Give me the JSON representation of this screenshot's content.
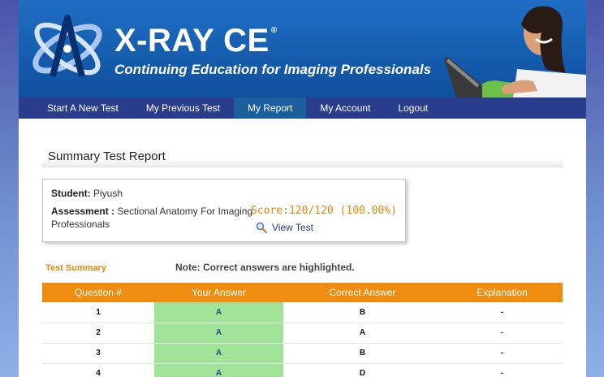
{
  "header": {
    "brand": "X-RAY CE",
    "brand_mark": "®",
    "tagline": "Continuing Education for Imaging Professionals"
  },
  "nav": {
    "items": [
      {
        "label": "Start A New Test",
        "active": false
      },
      {
        "label": "My Previous Test",
        "active": false
      },
      {
        "label": "My Report",
        "active": true
      },
      {
        "label": "My Account",
        "active": false
      },
      {
        "label": "Logout",
        "active": false
      }
    ]
  },
  "report": {
    "title": "Summary Test Report",
    "student_label": "Student:",
    "student_name": "Piyush",
    "assessment_label": "Assessment :",
    "assessment_name": "Sectional Anatomy For Imaging Professionals",
    "score": "Score:120/120 (100.00%)",
    "view_test": "View Test",
    "summary_label": "Test Summary",
    "note": "Note: Correct answers are highlighted."
  },
  "table": {
    "headers": [
      "Question #",
      "Your Answer",
      "Correct Answer",
      "Explanation"
    ],
    "rows": [
      [
        "1",
        "A",
        "B",
        "-"
      ],
      [
        "2",
        "A",
        "A",
        "-"
      ],
      [
        "3",
        "A",
        "B",
        "-"
      ],
      [
        "4",
        "A",
        "D",
        "-"
      ]
    ]
  },
  "colors": {
    "banner": "#1f6fc4",
    "nav": "#2a3c8c",
    "nav_active": "#1b5e9c",
    "table_header": "#f08c10",
    "answer_highlight": "#a2e39a",
    "score": "#e8870a"
  },
  "icons": {
    "logo": "atom-logo-icon",
    "view_test": "magnifier-icon"
  }
}
